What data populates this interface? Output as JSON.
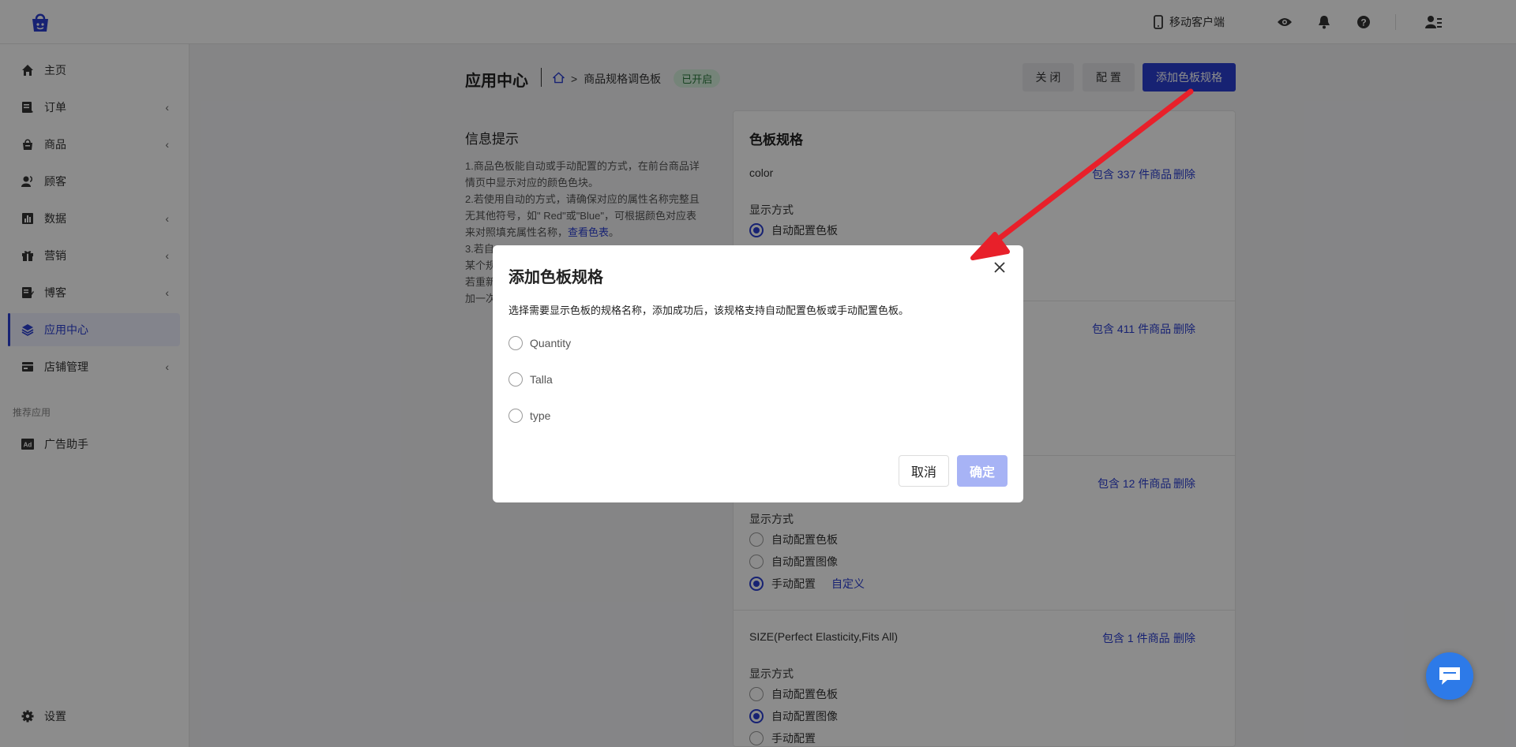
{
  "topbar": {
    "mobile_label": "移动客户端",
    "icons": [
      "eye-icon",
      "bell-icon",
      "help-icon",
      "user-menu-icon"
    ]
  },
  "sidebar": {
    "items": [
      {
        "label": "主页",
        "icon": "home-icon",
        "has_chevron": false,
        "active": false
      },
      {
        "label": "订单",
        "icon": "order-icon",
        "has_chevron": true,
        "active": false
      },
      {
        "label": "商品",
        "icon": "shop-icon",
        "has_chevron": true,
        "active": false
      },
      {
        "label": "顾客",
        "icon": "customers-icon",
        "has_chevron": false,
        "active": false
      },
      {
        "label": "数据",
        "icon": "chart-icon",
        "has_chevron": true,
        "active": false
      },
      {
        "label": "营销",
        "icon": "gift-icon",
        "has_chevron": true,
        "active": false
      },
      {
        "label": "博客",
        "icon": "blog-icon",
        "has_chevron": true,
        "active": false
      },
      {
        "label": "应用中心",
        "icon": "layers-icon",
        "has_chevron": false,
        "active": true
      },
      {
        "label": "店铺管理",
        "icon": "store-icon",
        "has_chevron": true,
        "active": false
      }
    ],
    "section_label": "推荐应用",
    "recommended": [
      {
        "label": "广告助手",
        "icon": "ad-icon"
      }
    ],
    "settings_label": "设置"
  },
  "header": {
    "title": "应用中心",
    "breadcrumb": "商品规格调色板",
    "badge": "已开启",
    "buttons": {
      "close": "关 闭",
      "config": "配 置",
      "add": "添加色板规格"
    }
  },
  "info": {
    "title": "信息提示",
    "line1": "1.商品色板能自动或手动配置的方式，在前台商品详情页中显示对应的颜色色块。",
    "line2": "2.若使用自动的方式，请确保对应的属性名称完整且无其他符号，如\" Red\"或\"Blue\"，可根据颜色对应表来对照填充属性名称，",
    "link": "查看色表",
    "line2_end": "。",
    "line3": "3.若自",
    "line4": "某个规",
    "line5": "若重新",
    "line6": "加一次"
  },
  "panel": {
    "title": "色板规格",
    "display_label": "显示方式",
    "delete_label": "删除",
    "options": {
      "auto_swatch": "自动配置色板",
      "auto_image": "自动配置图像",
      "manual": "手动配置",
      "custom": "自定义"
    },
    "sections": [
      {
        "name": "color",
        "count": "包含 337 件商品"
      },
      {
        "name": "",
        "count": "包含 411 件商品"
      },
      {
        "name": "",
        "count": "包含 12 件商品"
      },
      {
        "name": "SIZE(Perfect Elasticity,Fits All)",
        "count": "包含 1 件商品"
      }
    ]
  },
  "modal": {
    "title": "添加色板规格",
    "description": "选择需要显示色板的规格名称，添加成功后，该规格支持自动配置色板或手动配置色板。",
    "options": [
      "Quantity",
      "Talla",
      "type"
    ],
    "cancel": "取消",
    "confirm": "确定"
  },
  "colors": {
    "accent": "#2b3ed1",
    "arrow": "#e8202a",
    "chat": "#2d7ae8"
  }
}
